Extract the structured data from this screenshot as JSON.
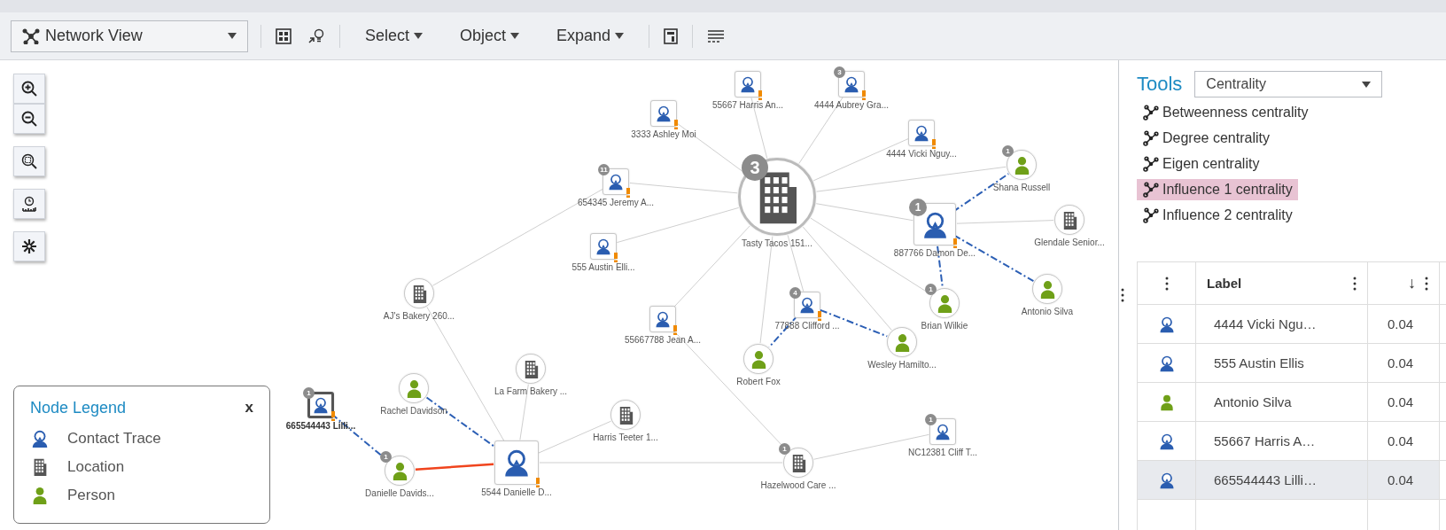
{
  "toolbar": {
    "view_select": {
      "value": "Network View"
    },
    "menus": [
      {
        "label": "Select"
      },
      {
        "label": "Object"
      },
      {
        "label": "Expand"
      }
    ]
  },
  "graph": {
    "nodes": [
      {
        "kind": "contact",
        "label": "55667 Harris An...",
        "alert": true,
        "selected": false
      },
      {
        "kind": "contact",
        "label": "4444 Aubrey Gra...",
        "badge": "3",
        "alert": true,
        "selected": false
      },
      {
        "kind": "contact",
        "label": "3333 Ashley Moi",
        "alert": true,
        "selected": false
      },
      {
        "kind": "contact",
        "label": "4444 Vicki Nguy...",
        "alert": true,
        "selected": false
      },
      {
        "kind": "contact",
        "label": "654345 Jeremy A...",
        "badge": "11",
        "alert": true,
        "selected": false
      },
      {
        "kind": "location",
        "label": "Tasty Tacos 151...",
        "badge": "3",
        "alert": false,
        "selected": false
      },
      {
        "kind": "person",
        "label": "Shana Russell",
        "badge": "1",
        "alert": false,
        "selected": false
      },
      {
        "kind": "contact",
        "label": "555 Austin Elli...",
        "alert": true,
        "selected": false
      },
      {
        "kind": "contact",
        "label": "887766 Damon De...",
        "badge": "1",
        "alert": true,
        "selected": false
      },
      {
        "kind": "location",
        "label": "Glendale Senior...",
        "alert": false,
        "selected": false
      },
      {
        "kind": "location",
        "label": "AJ's Bakery 260...",
        "alert": false,
        "selected": false
      },
      {
        "kind": "contact",
        "label": "55667788 Jean A...",
        "alert": true,
        "selected": false
      },
      {
        "kind": "contact",
        "label": "77888 Clifford ...",
        "badge": "4",
        "alert": true,
        "selected": false
      },
      {
        "kind": "person",
        "label": "Brian Wilkie",
        "badge": "1",
        "alert": false,
        "selected": false
      },
      {
        "kind": "person",
        "label": "Antonio Silva",
        "alert": false,
        "selected": false
      },
      {
        "kind": "location",
        "label": "La Farm Bakery ...",
        "alert": false,
        "selected": false
      },
      {
        "kind": "person",
        "label": "Robert Fox",
        "alert": false,
        "selected": false
      },
      {
        "kind": "person",
        "label": "Wesley Hamilto...",
        "alert": false,
        "selected": false
      },
      {
        "kind": "contact",
        "label": "665544443 Lilli...",
        "badge": "1",
        "alert": true,
        "selected": true
      },
      {
        "kind": "person",
        "label": "Rachel Davidson",
        "alert": false,
        "selected": false
      },
      {
        "kind": "location",
        "label": "Harris Teeter 1...",
        "alert": false,
        "selected": false
      },
      {
        "kind": "contact",
        "label": "NC12381 Cliff T...",
        "badge": "1",
        "alert": false,
        "selected": false
      },
      {
        "kind": "person",
        "label": "Danielle Davids...",
        "badge": "1",
        "alert": false,
        "selected": false
      },
      {
        "kind": "contact",
        "label": "5544 Danielle D...",
        "alert": true,
        "selected": false
      },
      {
        "kind": "location",
        "label": "Hazelwood Care ...",
        "badge": "1",
        "alert": false,
        "selected": false
      }
    ]
  },
  "legend": {
    "title": "Node Legend",
    "close": "x",
    "items": [
      {
        "kind": "contact",
        "label": "Contact Trace"
      },
      {
        "kind": "location",
        "label": "Location"
      },
      {
        "kind": "person",
        "label": "Person"
      }
    ]
  },
  "tools": {
    "title": "Tools",
    "select": "Centrality",
    "items": [
      {
        "label": "Betweenness centrality",
        "selected": false
      },
      {
        "label": "Degree centrality",
        "selected": false
      },
      {
        "label": "Eigen centrality",
        "selected": false
      },
      {
        "label": "Influence 1 centrality",
        "selected": true
      },
      {
        "label": "Influence 2 centrality",
        "selected": false
      }
    ]
  },
  "table": {
    "columns": [
      {
        "kind": "icon"
      },
      {
        "kind": "text",
        "label": "Label"
      },
      {
        "kind": "value",
        "label": "↓"
      }
    ],
    "rows": [
      {
        "kind": "contact",
        "label": "4444 Vicki Ngu…",
        "value": "0.04",
        "selected": false
      },
      {
        "kind": "contact",
        "label": "555 Austin Ellis",
        "value": "0.04",
        "selected": false
      },
      {
        "kind": "person",
        "label": "Antonio Silva",
        "value": "0.04",
        "selected": false
      },
      {
        "kind": "contact",
        "label": "55667 Harris A…",
        "value": "0.04",
        "selected": false
      },
      {
        "kind": "contact",
        "label": "665544443 Lilli…",
        "value": "0.04",
        "selected": true
      }
    ]
  }
}
